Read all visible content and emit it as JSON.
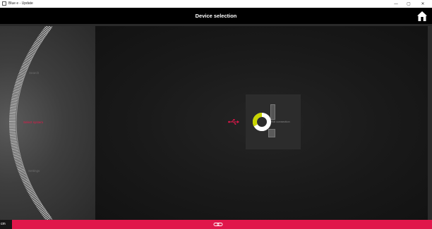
{
  "window": {
    "title": "Blue e - Update",
    "minimize_glyph": "—",
    "maximize_glyph": "▢",
    "close_glyph": "✕"
  },
  "header": {
    "title": "Device selection",
    "home_icon": "home-icon"
  },
  "sidebar": {
    "items": [
      {
        "label": "Search",
        "active": false
      },
      {
        "label": "Select system",
        "active": true
      },
      {
        "label": "Settings",
        "active": false
      }
    ]
  },
  "main": {
    "connection_label": "USB connection",
    "usb_icon": "usb-icon",
    "loading": true
  },
  "status_bar": {
    "left_text": "cm",
    "link_icon": "link-icon"
  },
  "colors": {
    "accent": "#e0174b",
    "spinner_accent": "#c8d400",
    "background": "#101010"
  }
}
